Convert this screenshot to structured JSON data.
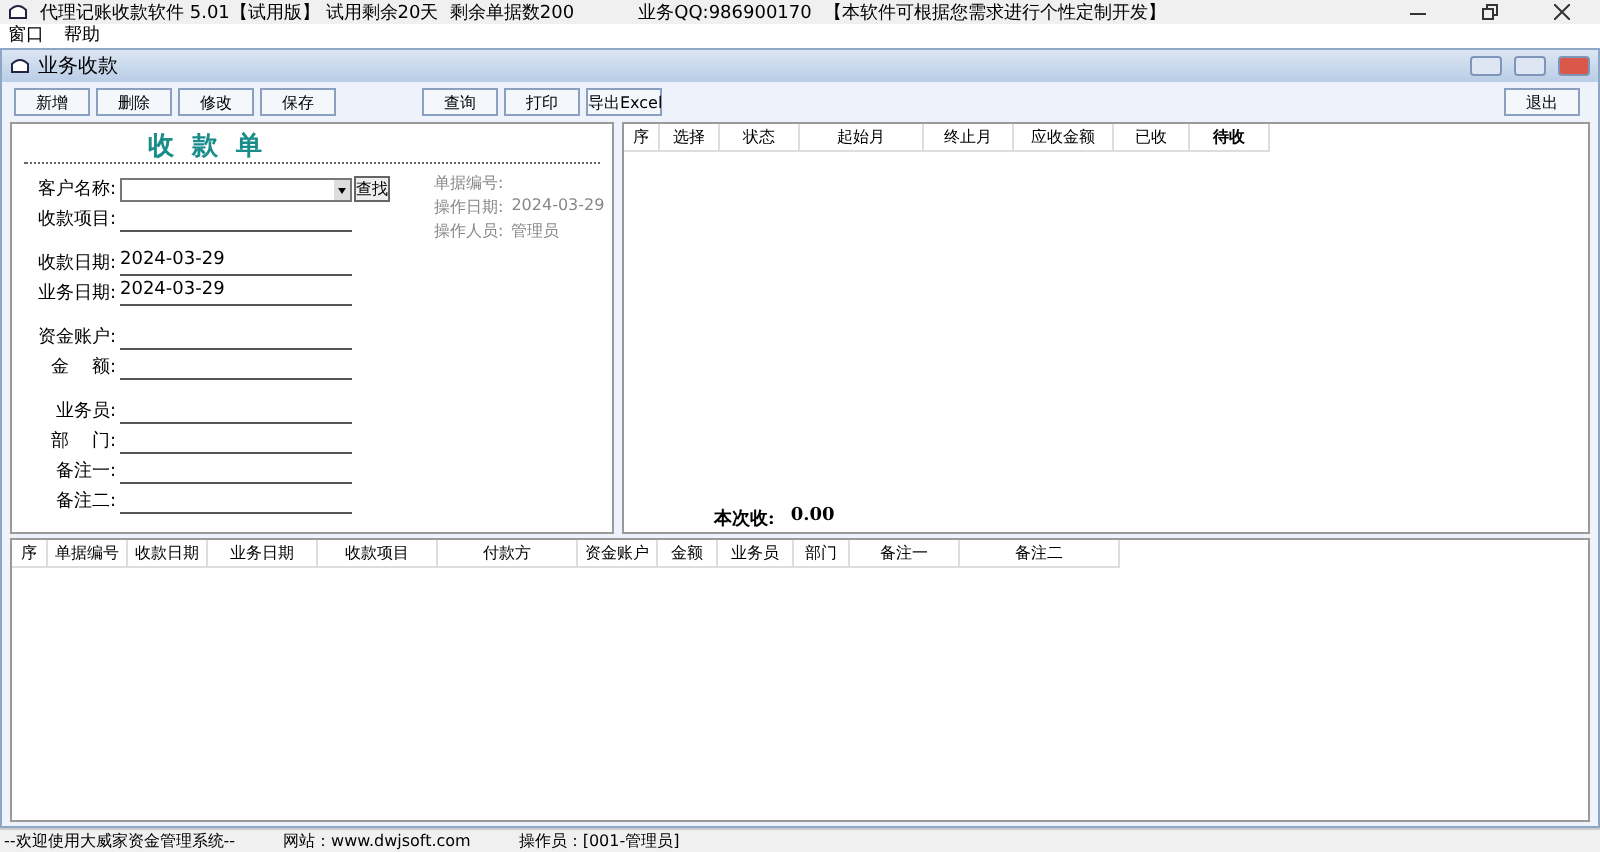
{
  "window": {
    "title": "代理记账收款软件 5.01【试用版】 试用剩余20天  剩余单据数200",
    "contact": "业务QQ:986900170",
    "notice": "【本软件可根据您需求进行个性定制开发】"
  },
  "menu": [
    "窗口",
    "帮助"
  ],
  "child_window": {
    "title": "业务收款"
  },
  "toolbar": [
    "新增",
    "删除",
    "修改",
    "保存",
    "查询",
    "打印",
    "导出Excel",
    "退出"
  ],
  "form": {
    "heading": "收  款  单",
    "search_button": "查找",
    "fields": [
      {
        "label": "客户名称:",
        "kind": "combo"
      },
      {
        "label": "收款项目:",
        "kind": "text"
      },
      {
        "label": "收款日期:",
        "value": "2024-03-29",
        "kind": "text"
      },
      {
        "label": "业务日期:",
        "value": "2024-03-29",
        "kind": "text"
      },
      {
        "label": "资金账户:",
        "kind": "text"
      },
      {
        "label": "金    额:",
        "kind": "text"
      },
      {
        "label": "业务员:",
        "kind": "text"
      },
      {
        "label": "部    门:",
        "kind": "text"
      },
      {
        "label": "备注一:",
        "kind": "text"
      },
      {
        "label": "备注二:",
        "kind": "text"
      }
    ],
    "info": [
      {
        "label": "单据编号:"
      },
      {
        "label": "操作日期:",
        "value": "2024-03-29"
      },
      {
        "label": "操作人员:",
        "value": "管理员"
      }
    ]
  },
  "months_table": {
    "columns": [
      "序",
      "选择",
      "状态",
      "起始月",
      "终止月",
      "应收金额",
      "已收",
      "待收"
    ],
    "total_label": "本次收:",
    "total_value": "0.00"
  },
  "records_table": {
    "columns": [
      "序",
      "单据编号",
      "收款日期",
      "业务日期",
      "收款项目",
      "付款方",
      "资金账户",
      "金额",
      "业务员",
      "部门",
      "备注一",
      "备注二"
    ]
  },
  "status_bar": [
    "--欢迎使用大威家资金管理系统--",
    "网站：www.dwjsoft.com",
    "操作员：[001-管理员]"
  ]
}
